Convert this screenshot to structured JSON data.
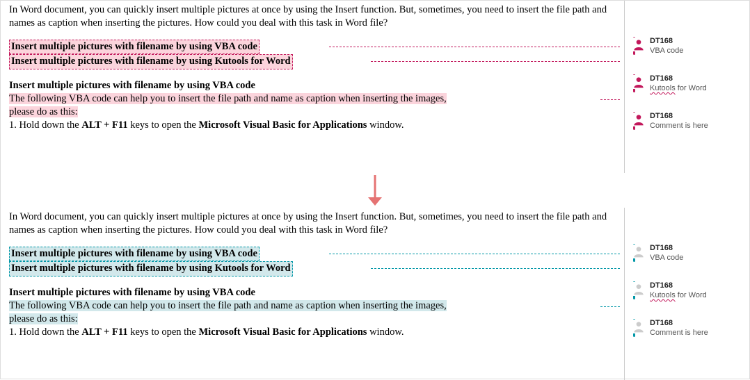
{
  "doc": {
    "intro": "In Word document, you can quickly insert multiple pictures at once by using the Insert function. But, sometimes, you need to insert the file path and names as caption when inserting the pictures. How could you deal with this task in Word file?",
    "link1": "Insert multiple pictures with filename by using VBA code",
    "link2": "Insert multiple pictures with filename by using Kutools for Word",
    "heading": "Insert multiple pictures with filename by using VBA code",
    "body_hl": "The following VBA code can help you to insert the file path and name as caption when inserting the images,",
    "body_tail": "please do as this:",
    "step_prefix": "1. Hold down the ",
    "step_keys": "ALT + F11",
    "step_mid": " keys to open the ",
    "step_app": "Microsoft Visual Basic for Applications",
    "step_suffix": " window."
  },
  "comments": [
    {
      "author": "DT168",
      "text_pre": "",
      "text": "VBA code",
      "squiggle": false
    },
    {
      "author": "DT168",
      "text_pre": "Kutools",
      "text": " for Word",
      "squiggle": true
    },
    {
      "author": "DT168",
      "text_pre": "",
      "text": "Comment is here",
      "squiggle": false
    }
  ]
}
